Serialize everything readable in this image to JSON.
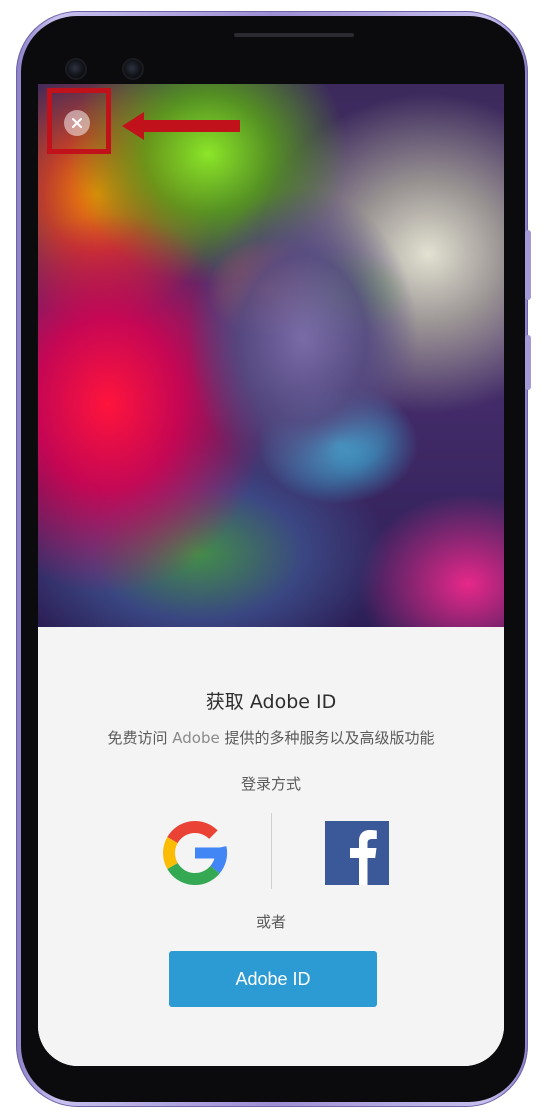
{
  "title": {
    "prefix": "获取",
    "name": "Adobe ID"
  },
  "subtitle": {
    "before": "免费访问",
    "brand": "Adobe",
    "after": "提供的多种服务以及高级版功能"
  },
  "login_label": "登录方式",
  "social": {
    "google_icon": "google-g-logo",
    "facebook_icon": "facebook-f-logo"
  },
  "or_label": "或者",
  "adobe_id_button_label": "Adobe ID",
  "colors": {
    "button_blue": "#2c9bd3",
    "facebook_blue": "#3b5998",
    "annotation_red": "#c1121c",
    "phone_lavender": "#a699d8"
  }
}
